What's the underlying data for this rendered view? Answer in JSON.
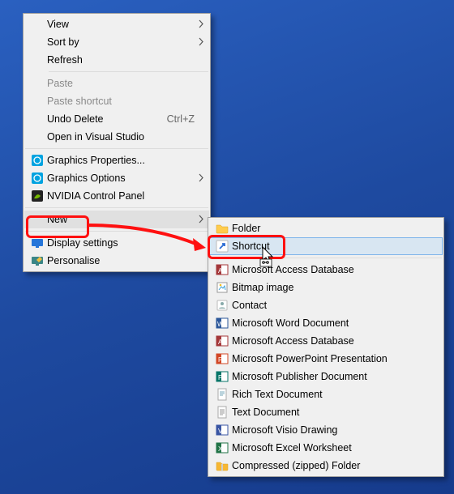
{
  "menu1": {
    "view": "View",
    "sortby": "Sort by",
    "refresh": "Refresh",
    "paste": "Paste",
    "pasteShortcut": "Paste shortcut",
    "undoDelete": "Undo Delete",
    "undoDeleteShortcut": "Ctrl+Z",
    "openVS": "Open in Visual Studio",
    "gfxProps": "Graphics Properties...",
    "gfxOpts": "Graphics Options",
    "nvcp": "NVIDIA Control Panel",
    "new": "New",
    "display": "Display settings",
    "personalise": "Personalise"
  },
  "menu2": {
    "folder": "Folder",
    "shortcut": "Shortcut",
    "access1": "Microsoft Access Database",
    "bitmap": "Bitmap image",
    "contact": "Contact",
    "word": "Microsoft Word Document",
    "access2": "Microsoft Access Database",
    "ppt": "Microsoft PowerPoint Presentation",
    "pub": "Microsoft Publisher Document",
    "rtf": "Rich Text Document",
    "txt": "Text Document",
    "visio": "Microsoft Visio Drawing",
    "xls": "Microsoft Excel Worksheet",
    "zip": "Compressed (zipped) Folder"
  },
  "colors": {
    "intel": "#00a3e0",
    "nvidia": "#76b900",
    "word": "#2b579a",
    "access": "#a4373a",
    "ppt": "#d24726",
    "pub": "#077568",
    "visio": "#3955a3",
    "xls": "#217346",
    "folder": "#ffcc4d",
    "zip": "#f7b733"
  }
}
